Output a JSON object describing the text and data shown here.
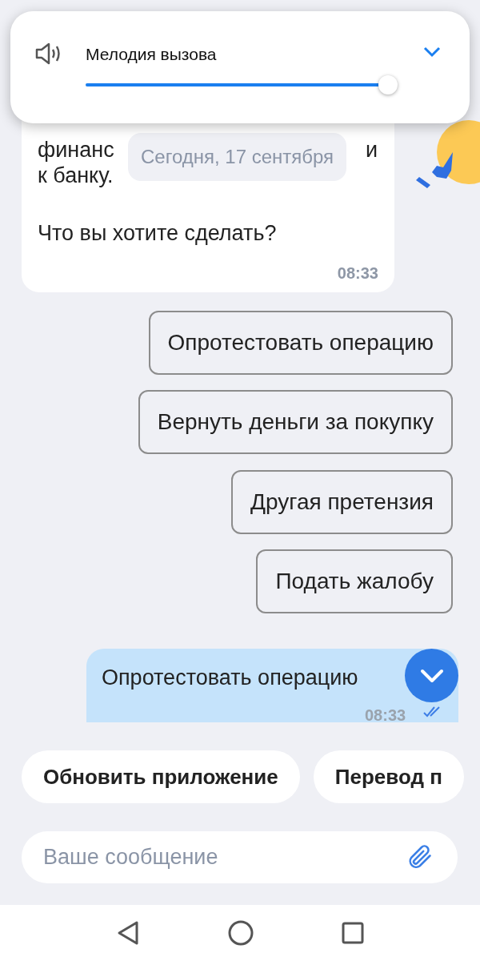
{
  "volume_popup": {
    "title": "Мелодия вызова",
    "level": 0.97
  },
  "bot_message": {
    "lines": [
      {
        "left": "финанс",
        "right": "и"
      },
      {
        "left": "к банку."
      }
    ],
    "question": "Что вы хотите сделать?",
    "time": "08:33"
  },
  "date_chip": "Сегодня, 17 сентября",
  "options": [
    "Опротестовать операцию",
    "Вернуть деньги за покупку",
    "Другая претензия",
    "Подать жалобу"
  ],
  "user_message": {
    "text": "Опротестовать операцию",
    "time": "08:33",
    "read": true
  },
  "quick_replies": [
    "Обновить приложение",
    "Перевод п"
  ],
  "composer": {
    "placeholder": "Ваше сообщение"
  }
}
